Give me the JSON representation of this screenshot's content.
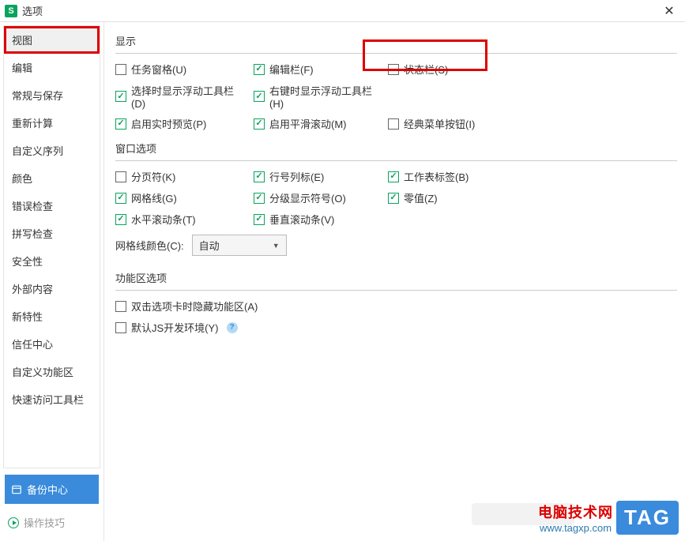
{
  "titlebar": {
    "appIconLetter": "S",
    "title": "选项"
  },
  "sidebar": {
    "items": [
      {
        "label": "视图",
        "selected": true
      },
      {
        "label": "编辑"
      },
      {
        "label": "常规与保存"
      },
      {
        "label": "重新计算"
      },
      {
        "label": "自定义序列"
      },
      {
        "label": "颜色"
      },
      {
        "label": "错误检查"
      },
      {
        "label": "拼写检查"
      },
      {
        "label": "安全性"
      },
      {
        "label": "外部内容"
      },
      {
        "label": "新特性"
      },
      {
        "label": "信任中心"
      },
      {
        "label": "自定义功能区"
      },
      {
        "label": "快速访问工具栏"
      }
    ],
    "backupLabel": "备份中心",
    "tipsLabel": "操作技巧"
  },
  "content": {
    "section1": {
      "title": "显示",
      "row1": {
        "c1": {
          "label": "任务窗格(U)",
          "checked": false
        },
        "c2": {
          "label": "编辑栏(F)",
          "checked": true
        },
        "c3": {
          "label": "状态栏(S)",
          "checked": false
        }
      },
      "row2": {
        "c1": {
          "label": "选择时显示浮动工具栏(D)",
          "checked": true
        },
        "c2": {
          "label": "右键时显示浮动工具栏(H)",
          "checked": true
        }
      },
      "row3": {
        "c1": {
          "label": "启用实时预览(P)",
          "checked": true
        },
        "c2": {
          "label": "启用平滑滚动(M)",
          "checked": true
        },
        "c3": {
          "label": "经典菜单按钮(I)",
          "checked": false
        }
      }
    },
    "section2": {
      "title": "窗口选项",
      "row1": {
        "c1": {
          "label": "分页符(K)",
          "checked": false
        },
        "c2": {
          "label": "行号列标(E)",
          "checked": true
        },
        "c3": {
          "label": "工作表标签(B)",
          "checked": true
        }
      },
      "row2": {
        "c1": {
          "label": "网格线(G)",
          "checked": true
        },
        "c2": {
          "label": "分级显示符号(O)",
          "checked": true
        },
        "c3": {
          "label": "零值(Z)",
          "checked": true
        }
      },
      "row3": {
        "c1": {
          "label": "水平滚动条(T)",
          "checked": true
        },
        "c2": {
          "label": "垂直滚动条(V)",
          "checked": true
        }
      },
      "gridColor": {
        "label": "网格线颜色(C):",
        "value": "自动"
      }
    },
    "section3": {
      "title": "功能区选项",
      "row1": {
        "c1": {
          "label": "双击选项卡时隐藏功能区(A)",
          "checked": false
        }
      },
      "row2": {
        "c1": {
          "label": "默认JS开发环境(Y)",
          "checked": false
        }
      }
    }
  },
  "watermark": {
    "cn": "电脑技术网",
    "url": "www.tagxp.com",
    "tag": "TAG"
  }
}
